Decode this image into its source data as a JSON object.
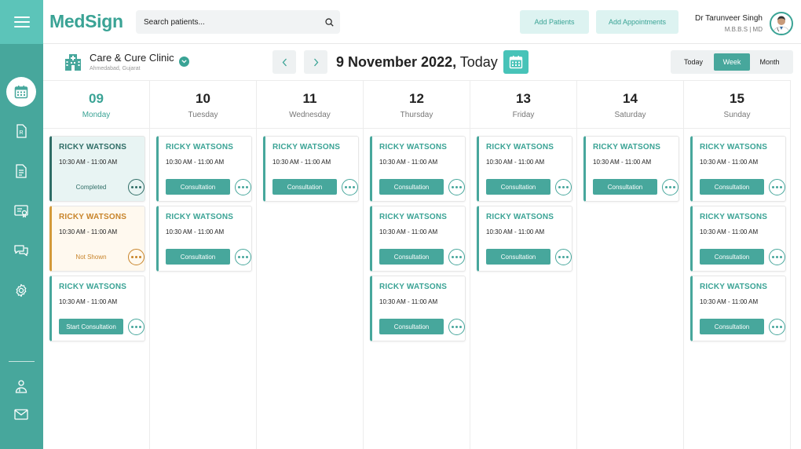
{
  "app": {
    "logo": "MedSign"
  },
  "header": {
    "search_placeholder": "Search patients...",
    "add_patients": "Add Patients",
    "add_appointments": "Add Appointments",
    "user_name": "Dr Tarunveer Singh",
    "user_degree": "M.B.B.S | MD"
  },
  "clinic": {
    "name": "Care & Cure Clinic",
    "location": "Ahmedabad, Gujarat"
  },
  "toolbar": {
    "date_bold": "9 November 2022,",
    "date_suffix": " Today",
    "views": [
      "Today",
      "Week",
      "Month"
    ],
    "active_view": "Week"
  },
  "sidebar": {
    "icons": [
      "calendar-icon",
      "prescription-icon",
      "document-icon",
      "billing-icon",
      "chat-icon",
      "settings-icon",
      "doctor-icon",
      "mail-icon"
    ],
    "active": "calendar-icon"
  },
  "days": [
    {
      "num": "09",
      "name": "Monday",
      "today": true
    },
    {
      "num": "10",
      "name": "Tuesday"
    },
    {
      "num": "11",
      "name": "Wednesday"
    },
    {
      "num": "12",
      "name": "Thursday"
    },
    {
      "num": "13",
      "name": "Friday"
    },
    {
      "num": "14",
      "name": "Saturday"
    },
    {
      "num": "15",
      "name": "Sunday"
    }
  ],
  "appointments": [
    [
      {
        "name": "RICKY WATSONS",
        "time": "10:30 AM - 11:00 AM",
        "status": "completed",
        "label": "Completed"
      },
      {
        "name": "RICKY WATSONS",
        "time": "10:30 AM - 11:00 AM",
        "status": "notshown",
        "label": "Not Shown"
      },
      {
        "name": "RICKY WATSONS",
        "time": "10:30 AM - 11:00 AM",
        "status": "action",
        "label": "Start Consultation"
      }
    ],
    [
      {
        "name": "RICKY WATSONS",
        "time": "10:30 AM - 11:00 AM",
        "status": "action",
        "label": "Consultation"
      },
      {
        "name": "RICKY WATSONS",
        "time": "10:30 AM - 11:00 AM",
        "status": "action",
        "label": "Consultation"
      }
    ],
    [
      {
        "name": "RICKY WATSONS",
        "time": "10:30 AM - 11:00 AM",
        "status": "action",
        "label": "Consultation"
      }
    ],
    [
      {
        "name": "RICKY WATSONS",
        "time": "10:30 AM - 11:00 AM",
        "status": "action",
        "label": "Consultation"
      },
      {
        "name": "RICKY WATSONS",
        "time": "10:30 AM - 11:00 AM",
        "status": "action",
        "label": "Consultation"
      },
      {
        "name": "RICKY WATSONS",
        "time": "10:30 AM - 11:00 AM",
        "status": "action",
        "label": "Consultation"
      }
    ],
    [
      {
        "name": "RICKY WATSONS",
        "time": "10:30 AM - 11:00 AM",
        "status": "action",
        "label": "Consultation"
      },
      {
        "name": "RICKY WATSONS",
        "time": "10:30 AM - 11:00 AM",
        "status": "action",
        "label": "Consultation"
      }
    ],
    [
      {
        "name": "RICKY WATSONS",
        "time": "10:30 AM - 11:00 AM",
        "status": "action",
        "label": "Consultation"
      }
    ],
    [
      {
        "name": "RICKY WATSONS",
        "time": "10:30 AM - 11:00 AM",
        "status": "action",
        "label": "Consultation"
      },
      {
        "name": "RICKY WATSONS",
        "time": "10:30 AM - 11:00 AM",
        "status": "action",
        "label": "Consultation"
      },
      {
        "name": "RICKY WATSONS",
        "time": "10:30 AM - 11:00 AM",
        "status": "action",
        "label": "Consultation"
      }
    ]
  ],
  "colors": {
    "primary": "#47a79c",
    "accent": "#3aa395",
    "completed": "#2f6d66",
    "not_shown": "#c8842a"
  }
}
